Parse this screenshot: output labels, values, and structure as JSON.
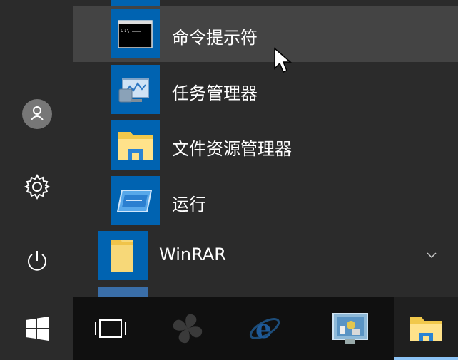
{
  "start_menu": {
    "items": [
      {
        "label": "命令提示符",
        "icon": "command-prompt-icon"
      },
      {
        "label": "任务管理器",
        "icon": "task-manager-icon"
      },
      {
        "label": "文件资源管理器",
        "icon": "file-explorer-icon"
      },
      {
        "label": "运行",
        "icon": "run-icon"
      }
    ],
    "group": {
      "label": "WinRAR",
      "icon": "folder-icon",
      "expand_icon": "chevron-down-icon"
    }
  },
  "rail": [
    {
      "name": "user-account",
      "icon": "user-icon"
    },
    {
      "name": "settings",
      "icon": "gear-icon"
    },
    {
      "name": "power",
      "icon": "power-icon"
    }
  ],
  "taskbar": {
    "items": [
      {
        "name": "start",
        "icon": "windows-logo-icon"
      },
      {
        "name": "task-view",
        "icon": "task-view-icon"
      },
      {
        "name": "app",
        "icon": "fan-icon"
      },
      {
        "name": "internet-explorer",
        "icon": "internet-explorer-icon"
      },
      {
        "name": "control-panel",
        "icon": "control-panel-icon"
      },
      {
        "name": "file-explorer",
        "icon": "file-explorer-icon"
      }
    ]
  },
  "colors": {
    "accent": "#0063b1",
    "menu_bg": "#2b2b2b",
    "hover": "#444444",
    "taskbar_bg": "#101010"
  }
}
